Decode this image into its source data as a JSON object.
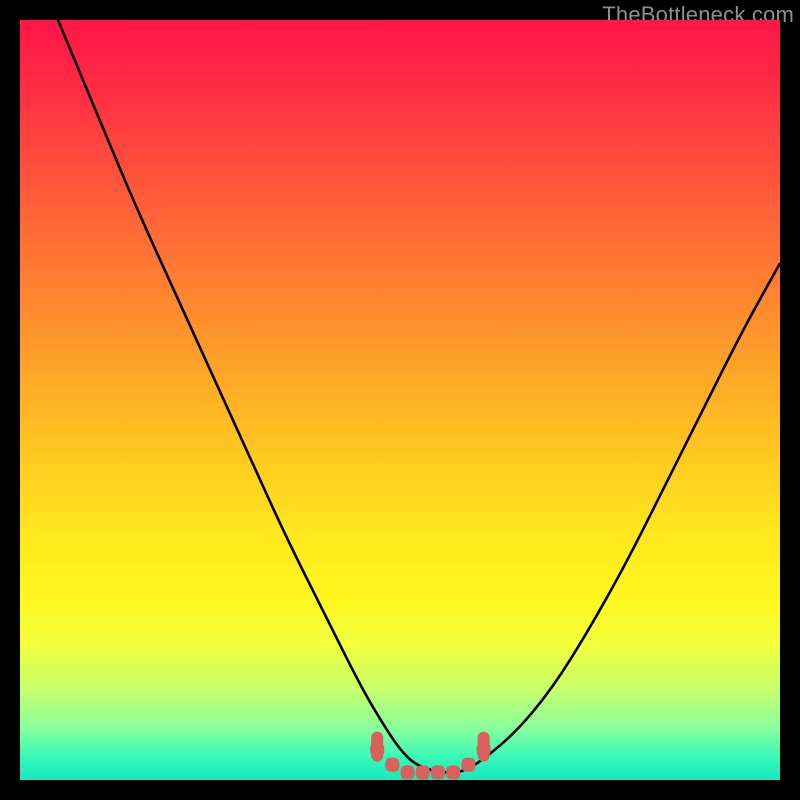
{
  "watermark": "TheBottleneck.com",
  "colors": {
    "frame": "#000000",
    "curve": "#000000",
    "marker": "#d9605b",
    "gradient_top": "#ff1648",
    "gradient_bottom": "#18e7c0"
  },
  "chart_data": {
    "type": "line",
    "title": "",
    "xlabel": "",
    "ylabel": "",
    "xlim": [
      0,
      100
    ],
    "ylim": [
      0,
      100
    ],
    "grid": false,
    "legend_position": "none",
    "series": [
      {
        "name": "curve",
        "x": [
          5,
          10,
          15,
          20,
          25,
          30,
          35,
          40,
          45,
          48,
          50,
          52,
          55,
          58,
          60,
          65,
          70,
          75,
          80,
          85,
          90,
          95,
          100
        ],
        "y": [
          100,
          88,
          76,
          65,
          54,
          43,
          32,
          22,
          12,
          7,
          4,
          2,
          1,
          1,
          2,
          6,
          12,
          20,
          29,
          39,
          49,
          59,
          68
        ]
      }
    ],
    "markers": {
      "name": "highlighted-region",
      "x": [
        47,
        49,
        51,
        53,
        55,
        57,
        59,
        61
      ],
      "y": [
        4,
        2,
        1,
        1,
        1,
        1,
        2,
        4
      ]
    }
  }
}
